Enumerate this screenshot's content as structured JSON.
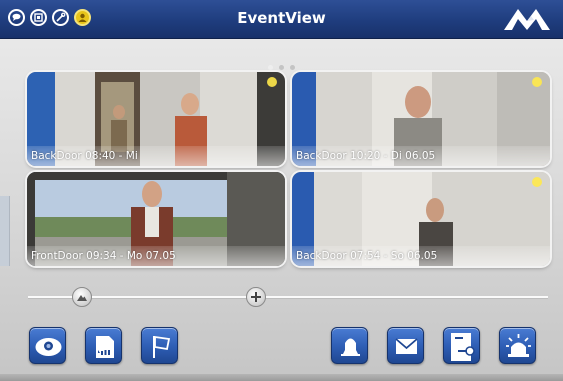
{
  "app": {
    "title": "EventView"
  },
  "header": {
    "icons": [
      "chat-icon",
      "camera-icon",
      "settings-icon",
      "user-icon"
    ],
    "logo": "mobotix-logo",
    "colors": {
      "bar": "#23438a",
      "accent": "#e8c41a"
    }
  },
  "pager": {
    "count": 3,
    "active": 0
  },
  "events": [
    {
      "caption": "BackDoor 08:40 - Mi",
      "scene": "door-open"
    },
    {
      "caption": "BackDoor 10:20 - Di 06.05",
      "scene": "man"
    },
    {
      "caption": "FrontDoor 09:34 - Mo 07.05",
      "scene": "outdoor"
    },
    {
      "caption": "BackDoor 07:54 - So 06.05",
      "scene": "woman"
    }
  ],
  "timeline": {
    "zoom_out_icon": "mountain-icon",
    "zoom_in_icon": "plus-icon"
  },
  "toolbar": {
    "left": [
      "camera-dome-icon",
      "sd-card-icon",
      "flag-icon"
    ],
    "right": [
      "bell-icon",
      "mail-icon",
      "door-key-icon",
      "alarm-light-icon"
    ]
  }
}
